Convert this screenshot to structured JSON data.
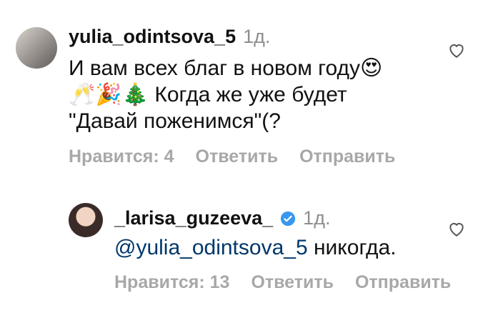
{
  "comments": [
    {
      "username": "yulia_odintsova_5",
      "time": "1д.",
      "lines": [
        "И вам всех благ в новом году😍",
        "🥂🎉🎄 Когда же уже будет",
        "\"Давай поженимся\"(?"
      ],
      "actions": {
        "likes": "Нравится: 4",
        "reply": "Ответить",
        "send": "Отправить"
      }
    },
    {
      "username": "_larisa_guzeeva_",
      "verified": true,
      "time": "1д.",
      "mention": "@yulia_odintsova_5",
      "text": " никогда.",
      "actions": {
        "likes": "Нравится: 13",
        "reply": "Ответить",
        "send": "Отправить"
      }
    }
  ],
  "colors": {
    "verified": "#3897f0",
    "mention": "#00376b",
    "muted": "#a8a8a8"
  },
  "icons": {
    "like": "heart-outline-icon",
    "verified": "verified-badge-icon"
  }
}
